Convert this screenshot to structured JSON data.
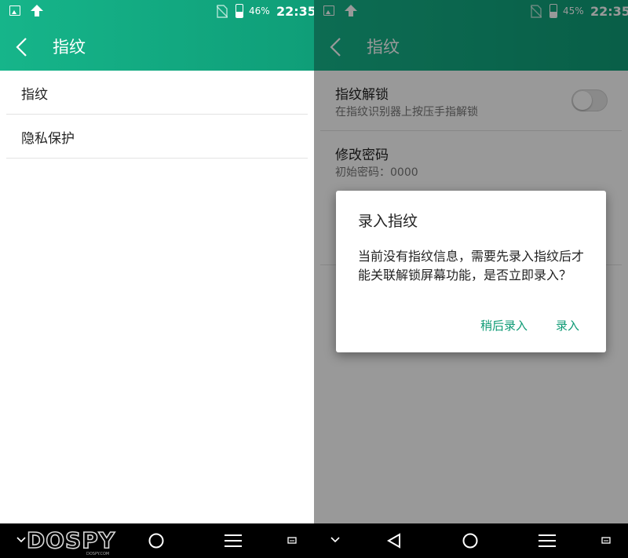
{
  "left": {
    "status": {
      "battery": "46%",
      "battery_level": 0.46,
      "time": "22:35"
    },
    "title": "指纹",
    "items": [
      {
        "label": "指纹"
      },
      {
        "label": "隐私保护"
      }
    ],
    "watermark": {
      "brand": "DOSPY",
      "domain": "DOSPY.COM"
    }
  },
  "right": {
    "status": {
      "battery": "45%",
      "battery_level": 0.45,
      "time": "22:35"
    },
    "title": "指纹",
    "settings": [
      {
        "title": "指纹解锁",
        "subtitle": "在指纹识别器上按压手指解锁",
        "toggle": false
      },
      {
        "title": "修改密码",
        "subtitle": "初始密码：0000"
      }
    ],
    "dialog": {
      "title": "录入指纹",
      "message": "当前没有指纹信息，需要先录入指纹后才能关联解锁屏幕功能，是否立即录入？",
      "later_label": "稍后录入",
      "enroll_label": "录入"
    }
  },
  "colors": {
    "accent": "#15b389",
    "dialog_button": "#0d9a74"
  }
}
